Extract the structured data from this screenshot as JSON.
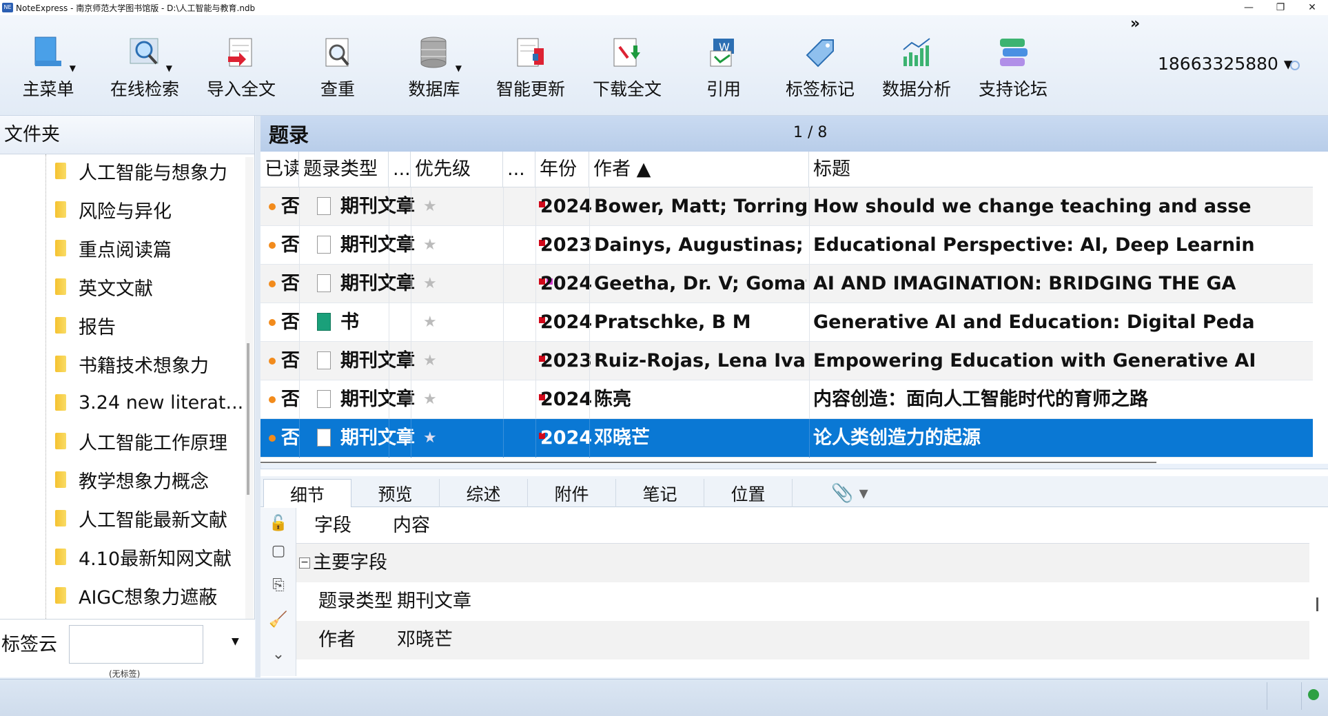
{
  "window": {
    "title": "NoteExpress - 南京师范大学图书馆版 - D:\\人工智能与教育.ndb",
    "app_icon": "NE",
    "controls": [
      "—",
      "❐",
      "✕"
    ]
  },
  "toolbar": {
    "items": [
      {
        "label": "主菜单",
        "icon": "main-menu-icon",
        "has_dropdown": true
      },
      {
        "label": "在线检索",
        "icon": "online-search-icon",
        "has_dropdown": true
      },
      {
        "label": "导入全文",
        "icon": "import-fulltext-icon"
      },
      {
        "label": "查重",
        "icon": "dedupe-icon"
      },
      {
        "label": "数据库",
        "icon": "database-icon",
        "has_dropdown": true
      },
      {
        "label": "智能更新",
        "icon": "smart-update-icon"
      },
      {
        "label": "下载全文",
        "icon": "download-fulltext-icon"
      },
      {
        "label": "引用",
        "icon": "cite-icon"
      },
      {
        "label": "标签标记",
        "icon": "tag-icon"
      },
      {
        "label": "数据分析",
        "icon": "analysis-icon"
      },
      {
        "label": "支持论坛",
        "icon": "forum-icon"
      }
    ],
    "overflow": "»",
    "user": "18663325880 ▾"
  },
  "folders": {
    "title": "文件夹",
    "items": [
      "人工智能与想象力",
      "风险与异化",
      "重点阅读篇",
      "英文文献",
      "报告",
      "书籍技术想象力",
      "3.24 new literat...",
      "人工智能工作原理",
      "教学想象力概念",
      "人工智能最新文献",
      "4.10最新知网文献",
      "AIGC想象力遮蔽"
    ]
  },
  "tagcloud": {
    "title": "标签云",
    "empty": "(无标签)"
  },
  "records": {
    "title": "题录",
    "page": "1 / 8",
    "columns": [
      "已读",
      "题录类型",
      "...",
      "优先级",
      "...",
      "年份",
      "作者 ▲",
      "标题"
    ],
    "rows": [
      {
        "read": "否",
        "type": "期刊文章",
        "book": false,
        "flags": 1,
        "year": "2024",
        "author": "Bower, Matt; Torrington, Jo",
        "title": "How should we change teaching and asse"
      },
      {
        "read": "否",
        "type": "期刊文章",
        "book": false,
        "flags": 1,
        "year": "2023",
        "author": "Dainys, Augustinas; Jašina..",
        "title": "Educational Perspective: AI, Deep Learnin"
      },
      {
        "read": "否",
        "type": "期刊文章",
        "book": false,
        "flags": 2,
        "year": "2024",
        "author": "Geetha, Dr. V; Gomathy, Dr.",
        "title": "AI AND IMAGINATION: BRIDGING THE GA"
      },
      {
        "read": "否",
        "type": "书",
        "book": true,
        "flags": 1,
        "year": "2024",
        "author": "Pratschke, B M",
        "title": "Generative AI and Education: Digital Peda"
      },
      {
        "read": "否",
        "type": "期刊文章",
        "book": false,
        "flags": 1,
        "year": "2023",
        "author": "Ruiz-Rojas, Lena Ivannova;",
        "title": "Empowering Education with Generative AI"
      },
      {
        "read": "否",
        "type": "期刊文章",
        "book": false,
        "flags": 1,
        "year": "2024",
        "author": "陈亮",
        "title": "内容创造：面向人工智能时代的育师之路"
      },
      {
        "read": "否",
        "type": "期刊文章",
        "book": false,
        "flags": 1,
        "year": "2024",
        "author": "邓晓芒",
        "title": "论人类创造力的起源"
      }
    ]
  },
  "detail": {
    "tabs": [
      "细节",
      "预览",
      "综述",
      "附件",
      "笔记",
      "位置"
    ],
    "headers": {
      "field": "字段",
      "content": "内容"
    },
    "group": "主要字段",
    "rows": [
      {
        "field": "题录类型",
        "value": "期刊文章"
      },
      {
        "field": "作者",
        "value": "邓晓芒"
      }
    ]
  },
  "colors": {
    "selection": "#0a78d4",
    "unread_dot": "#f28b1c",
    "priority_flag": "#d1081a"
  }
}
